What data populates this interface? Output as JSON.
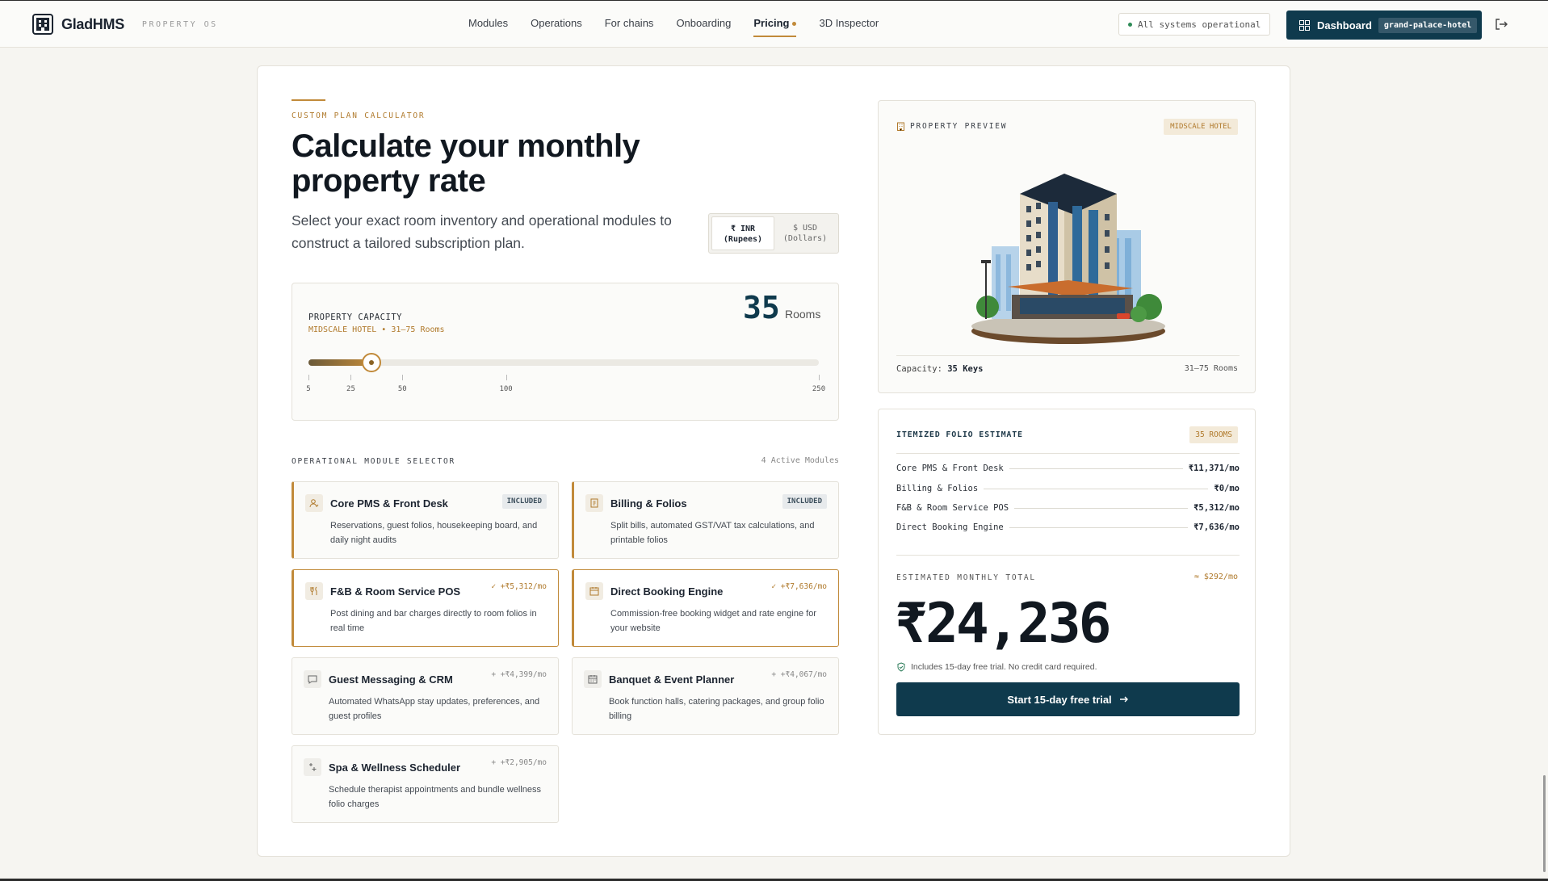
{
  "nav": {
    "brand": "GladHMS",
    "brand_sub": "PROPERTY OS",
    "links": [
      "Modules",
      "Operations",
      "For chains",
      "Onboarding",
      "Pricing",
      "3D Inspector"
    ],
    "active": "Pricing",
    "status": "All systems operational",
    "dashboard_label": "Dashboard",
    "dashboard_tag": "grand-palace-hotel"
  },
  "hero": {
    "eyebrow": "CUSTOM PLAN CALCULATOR",
    "title": "Calculate your monthly property rate",
    "lede": "Select your exact room inventory and operational modules to construct a tailored subscription plan."
  },
  "currency": {
    "options": [
      {
        "symbol": "₹ INR",
        "name": "(Rupees)",
        "selected": true
      },
      {
        "symbol": "$ USD",
        "name": "(Dollars)",
        "selected": false
      }
    ]
  },
  "capacity": {
    "label": "PROPERTY CAPACITY",
    "tier": "MIDSCALE HOTEL • 31–75 Rooms",
    "rooms": 35,
    "rooms_display": "35",
    "unit": "Rooms",
    "slider_min": 5,
    "slider_max": 250,
    "ticks": [
      5,
      25,
      50,
      100,
      250
    ]
  },
  "modules": {
    "heading": "OPERATIONAL MODULE SELECTOR",
    "count": "4 Active Modules",
    "items": [
      {
        "title": "Core PMS & Front Desk",
        "desc": "Reservations, guest folios, housekeeping board, and daily night audits",
        "state": "included",
        "tag": "INCLUDED",
        "icon": "user-icon"
      },
      {
        "title": "Billing & Folios",
        "desc": "Split bills, automated GST/VAT tax calculations, and printable folios",
        "state": "included",
        "tag": "INCLUDED",
        "icon": "receipt-icon"
      },
      {
        "title": "F&B & Room Service POS",
        "desc": "Post dining and bar charges directly to room folios in real time",
        "state": "selected",
        "tag": "✓ +₹5,312/mo",
        "icon": "utensils-icon"
      },
      {
        "title": "Direct Booking Engine",
        "desc": "Commission-free booking widget and rate engine for your website",
        "state": "selected",
        "tag": "✓ +₹7,636/mo",
        "icon": "calendar-icon"
      },
      {
        "title": "Guest Messaging & CRM",
        "desc": "Automated WhatsApp stay updates, preferences, and guest profiles",
        "state": "off",
        "tag": "+ +₹4,399/mo",
        "icon": "message-icon"
      },
      {
        "title": "Banquet & Event Planner",
        "desc": "Book function halls, catering packages, and group folio billing",
        "state": "off",
        "tag": "+ +₹4,067/mo",
        "icon": "calendar-icon"
      },
      {
        "title": "Spa & Wellness Scheduler",
        "desc": "Schedule therapist appointments and bundle wellness folio charges",
        "state": "off",
        "tag": "+ +₹2,905/mo",
        "icon": "sparkle-icon"
      }
    ]
  },
  "preview": {
    "label": "PROPERTY PREVIEW",
    "badge": "MIDSCALE HOTEL",
    "capacity_label": "Capacity:",
    "capacity_value": "35 Keys",
    "range": "31–75 Rooms"
  },
  "estimate": {
    "title": "ITEMIZED FOLIO ESTIMATE",
    "badge": "35 ROOMS",
    "rows": [
      {
        "name": "Core PMS & Front Desk",
        "value": "₹11,371/mo"
      },
      {
        "name": "Billing & Folios",
        "value": "₹0/mo"
      },
      {
        "name": "F&B & Room Service POS",
        "value": "₹5,312/mo"
      },
      {
        "name": "Direct Booking Engine",
        "value": "₹7,636/mo"
      }
    ],
    "total_label": "ESTIMATED MONTHLY TOTAL",
    "total_usd": "≈ $292/mo",
    "total": "₹24,236",
    "trial_note": "Includes 15-day free trial. No credit card required.",
    "cta": "Start 15-day free trial"
  },
  "colors": {
    "navy": "#0f3a4d",
    "accent": "#c18a3a"
  }
}
